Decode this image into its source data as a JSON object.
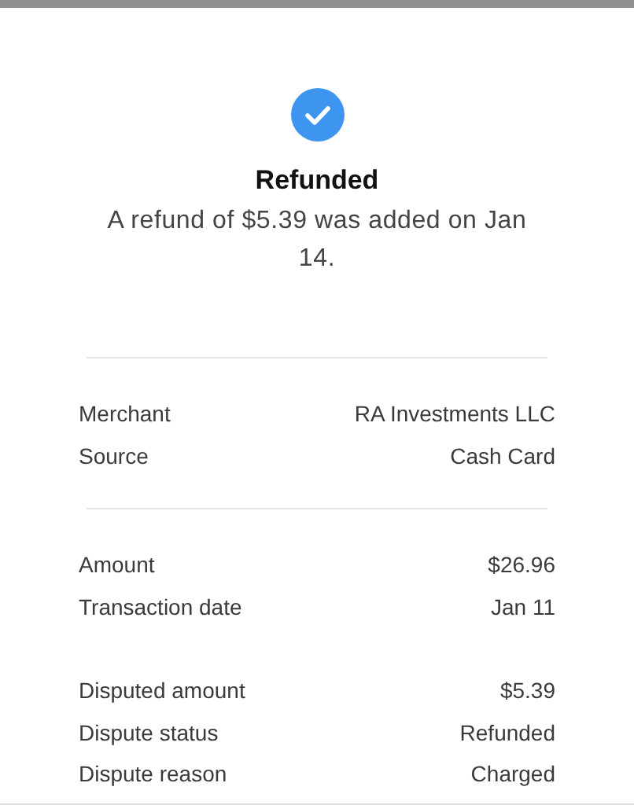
{
  "status": {
    "title": "Refunded",
    "message": "A refund of $5.39 was added on Jan 14."
  },
  "sections": [
    {
      "divider_above": true,
      "rows": [
        {
          "label": "Merchant",
          "value": "RA Investments LLC"
        },
        {
          "label": "Source",
          "value": "Cash Card"
        }
      ]
    },
    {
      "divider_above": true,
      "rows": [
        {
          "label": "Amount",
          "value": "$26.96"
        },
        {
          "label": "Transaction date",
          "value": "Jan 11"
        }
      ]
    },
    {
      "divider_above": false,
      "rows": [
        {
          "label": "Disputed amount",
          "value": "$5.39"
        },
        {
          "label": "Dispute status",
          "value": "Refunded"
        },
        {
          "label": "Dispute reason",
          "value": "Charged"
        }
      ]
    }
  ]
}
